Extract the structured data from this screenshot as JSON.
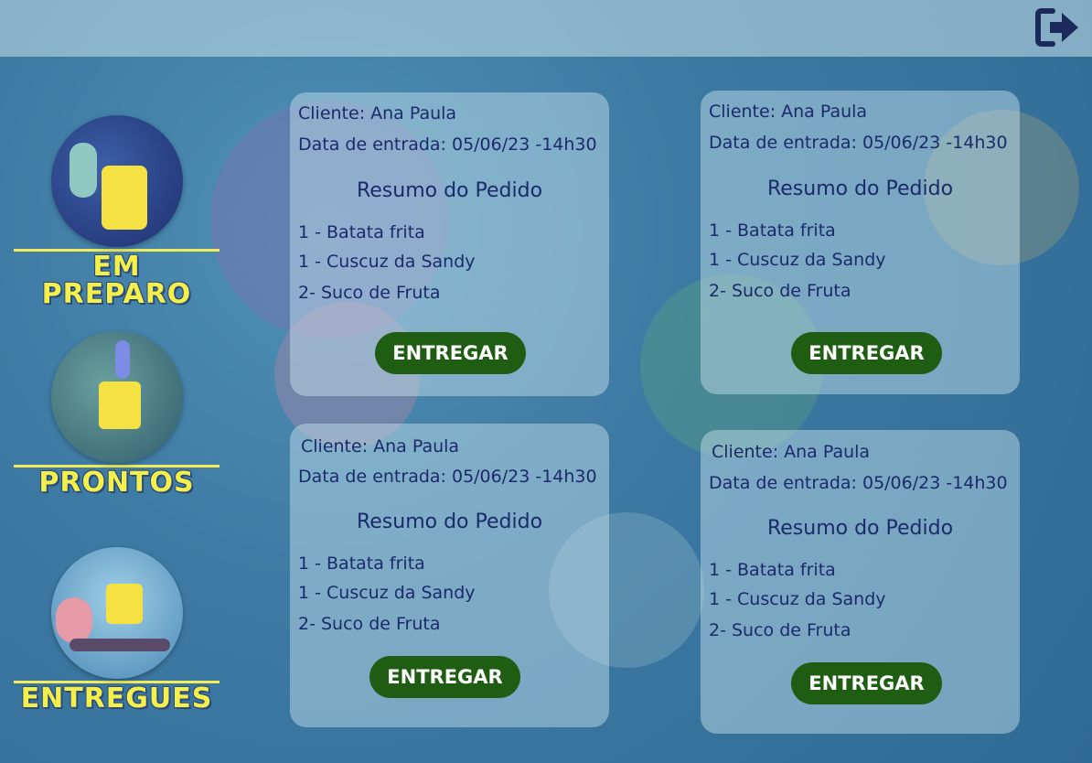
{
  "header": {
    "logout_icon": "sign-out-icon"
  },
  "sidebar": {
    "items": [
      {
        "label": "EM PREPARO",
        "icon": "kitchen-cooking-image"
      },
      {
        "label": "PRONTOS",
        "icon": "chef-serving-image"
      },
      {
        "label": "ENTREGUES",
        "icon": "motorcycle-delivery-image"
      }
    ]
  },
  "orders": [
    {
      "client": "Cliente: Ana Paula",
      "date": "Data de entrada: 05/06/23 -14h30",
      "summary_title": "Resumo do Pedido",
      "items": [
        "1 - Batata frita",
        "1 - Cuscuz da Sandy",
        "2- Suco de Fruta"
      ],
      "button": "ENTREGAR"
    },
    {
      "client": "Cliente: Ana Paula",
      "date": "Data de entrada: 05/06/23 -14h30",
      "summary_title": "Resumo do Pedido",
      "items": [
        "1 - Batata frita",
        "1 - Cuscuz da Sandy",
        "2- Suco de Fruta"
      ],
      "button": "ENTREGAR"
    },
    {
      "client": "Cliente: Ana Paula",
      "date": "Data de entrada: 05/06/23 -14h30",
      "summary_title": "Resumo do Pedido",
      "items": [
        "1 - Batata frita",
        "1 - Cuscuz da Sandy",
        "2- Suco de Fruta"
      ],
      "button": "ENTREGAR"
    },
    {
      "client": "Cliente: Ana Paula",
      "date": "Data de entrada: 05/06/23 -14h30",
      "summary_title": "Resumo do Pedido",
      "items": [
        "1 - Batata frita",
        "1 - Cuscuz da Sandy",
        "2- Suco de Fruta"
      ],
      "button": "ENTREGAR"
    }
  ],
  "colors": {
    "accent_yellow": "#f5ef4a",
    "button_green": "#1f5e12",
    "text_navy": "#1b2a6b"
  }
}
